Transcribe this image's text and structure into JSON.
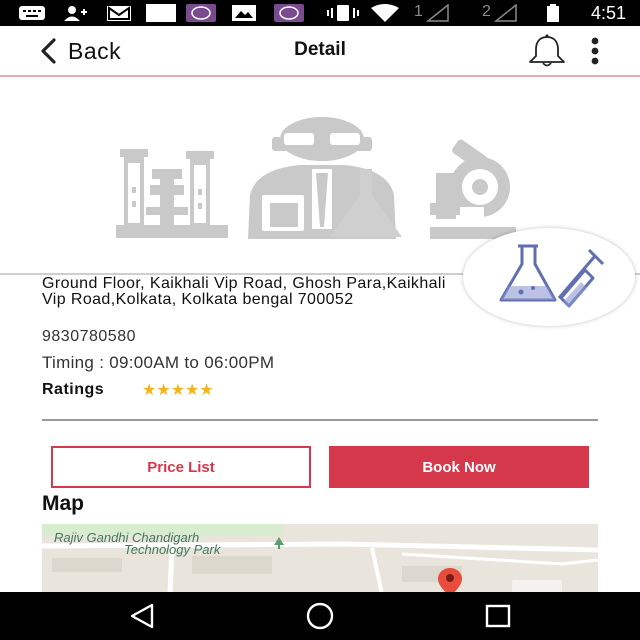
{
  "status_bar": {
    "sim1": "1",
    "sim2": "2",
    "time": "4:51"
  },
  "header": {
    "back_label": "Back",
    "title": "Detail"
  },
  "details": {
    "address": "Ground Floor, Kaikhali Vip Road, Ghosh Para,Kaikhali Vip Road,Kolkata, Kolkata bengal 700052",
    "phone": "9830780580",
    "timing": "Timing : 09:00AM to 06:00PM",
    "ratings_label": "Ratings",
    "stars": "★★★★★",
    "rating_value": 5
  },
  "actions": {
    "price_list": "Price List",
    "book_now": "Book Now"
  },
  "map": {
    "heading": "Map",
    "label_line1": "Rajiv Gandhi Chandigarh",
    "label_line2": "Technology Park"
  },
  "colors": {
    "accent": "#d6384b",
    "star": "#f3b51a",
    "header_border": "#e8a9ad",
    "illustration": "#c9c9c9",
    "flask": "#5f6fb2"
  }
}
